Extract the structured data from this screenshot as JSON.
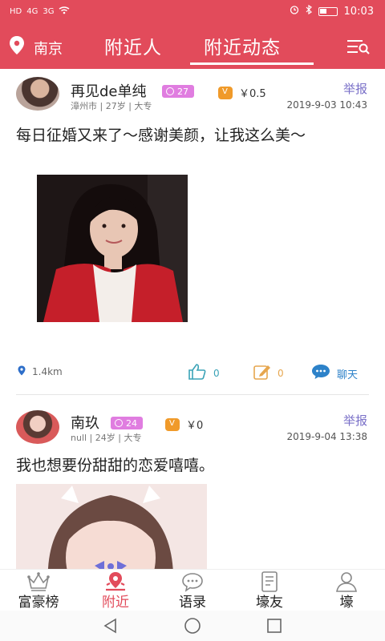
{
  "status_bar": {
    "network": "HD",
    "signal1": "4G",
    "signal2": "3G",
    "time": "10:03"
  },
  "header": {
    "location": "南京",
    "tabs": [
      {
        "label": "附近人",
        "active": false
      },
      {
        "label": "附近动态",
        "active": true
      }
    ],
    "menu_icon": "filter-search-icon"
  },
  "posts": [
    {
      "username": "再见de单纯",
      "badge": "27",
      "vip_amount": "￥0.5",
      "report": "举报",
      "meta": "漳州市 | 27岁 | 大专",
      "time": "2019-9-03 10:43",
      "content": "每日征婚又来了～感谢美颜，让我这么美～",
      "distance": "1.4km",
      "likes": "0",
      "comments": "0",
      "chat": "聊天"
    },
    {
      "username": "南玖",
      "badge": "24",
      "vip_amount": "￥0",
      "report": "举报",
      "meta": "null | 24岁 | 大专",
      "time": "2019-9-04 13:38",
      "content": "我也想要份甜甜的恋爱嘻嘻。"
    }
  ],
  "bottom_nav": [
    {
      "label": "富豪榜",
      "icon": "crown-icon",
      "active": false
    },
    {
      "label": "附近",
      "icon": "location-icon",
      "active": true
    },
    {
      "label": "语录",
      "icon": "chat-bubble-icon",
      "active": false
    },
    {
      "label": "壕友",
      "icon": "contact-card-icon",
      "active": false
    },
    {
      "label": "壕",
      "icon": "user-icon",
      "active": false
    }
  ],
  "colors": {
    "primary": "#e24b5b",
    "report": "#7a70c8",
    "badge": "#e07de0",
    "like": "#3aa3b7",
    "comment": "#e6a64e",
    "chat": "#2d82c9"
  }
}
